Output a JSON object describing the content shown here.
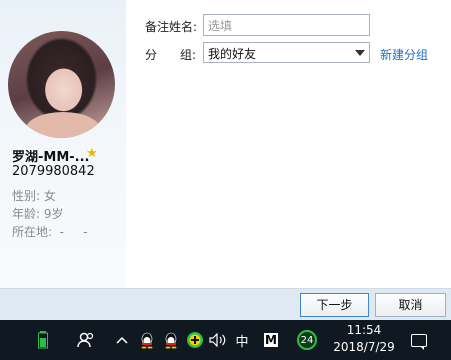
{
  "profile": {
    "nickname": "罗湖-MM-...",
    "qq_number": "2079980842",
    "gender": "性别: 女",
    "age": "年龄: 9岁",
    "location": "所在地:  -     -"
  },
  "form": {
    "remark_label": "备注姓名:",
    "remark_placeholder": "选填",
    "group_label_a": "分",
    "group_label_b": "组:",
    "group_value": "我的好友",
    "new_group_link": "新建分组"
  },
  "buttons": {
    "next": "下一步",
    "cancel": "取消"
  },
  "taskbar": {
    "ime": "中",
    "m_label": "M",
    "badge_count": "24",
    "time": "11:54",
    "date": "2018/7/29"
  }
}
